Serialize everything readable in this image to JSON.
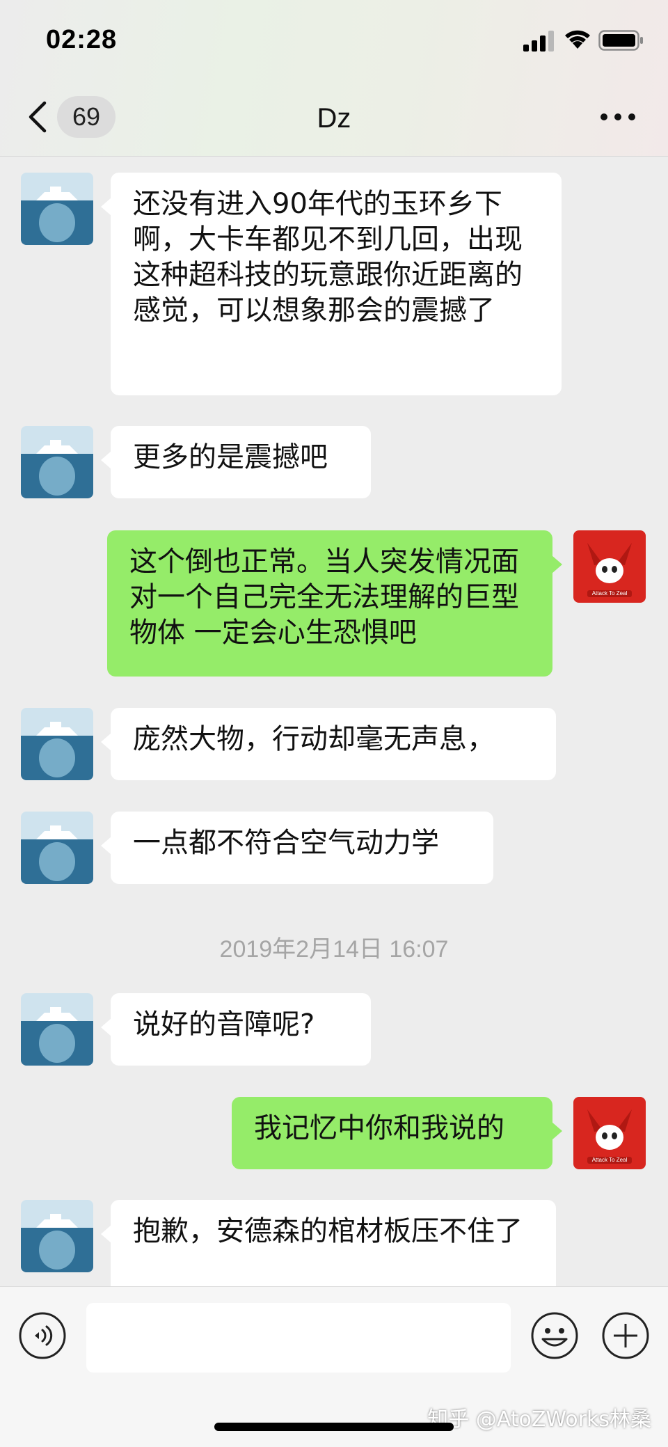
{
  "status_bar": {
    "time": "02:28"
  },
  "nav": {
    "unread_count": "69",
    "title": "Dz"
  },
  "messages": [
    {
      "side": "in",
      "text": "还没有进入90年代的玉环乡下啊，大卡车都见不到几回，出现这种超科技的玩意跟你近距离的感觉，可以想象那会的震撼了"
    },
    {
      "side": "in",
      "text": "更多的是震撼吧"
    },
    {
      "side": "out",
      "text": "这个倒也正常。当人突发情况面对一个自己完全无法理解的巨型物体 一定会心生恐惧吧"
    },
    {
      "side": "in",
      "text": "庞然大物，行动却毫无声息，"
    },
    {
      "side": "in",
      "text": "一点都不符合空气动力学"
    },
    {
      "side": "in",
      "text": "说好的音障呢?"
    },
    {
      "side": "out",
      "text": "我记忆中你和我说的"
    },
    {
      "side": "in",
      "text": "抱歉，安德森的棺材板压不住了"
    }
  ],
  "timestamp": "2019年2月14日 16:07",
  "avatar_red_caption": "Attack To Zeal",
  "watermark": "知乎 @AtoZWorks林桑",
  "icons": {
    "back": "chevron-left-icon",
    "more": "more-dots-icon",
    "voice": "voice-icon",
    "emoji": "emoji-icon",
    "plus": "plus-icon"
  },
  "colors": {
    "outgoing_bubble": "#95ec69",
    "incoming_bubble": "#ffffff",
    "background": "#ededed"
  }
}
